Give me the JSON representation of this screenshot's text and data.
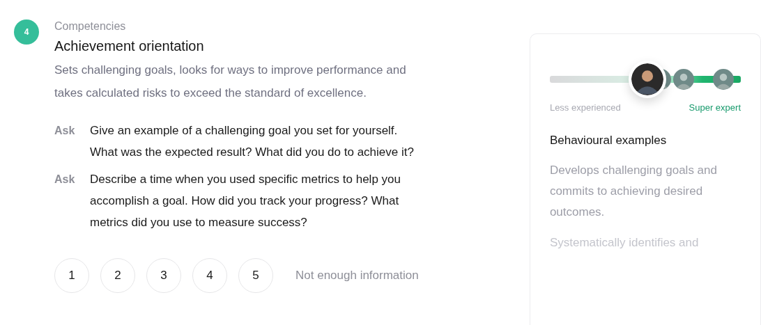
{
  "competency": {
    "number": "4",
    "category": "Competencies",
    "title": "Achievement orientation",
    "description": "Sets challenging goals, looks for ways to improve performance and takes calculated risks to exceed the standard of excellence."
  },
  "questions": [
    {
      "label": "Ask",
      "text": "Give an example of a challenging goal you set for yourself. What was the expected result? What did you do to achieve it?"
    },
    {
      "label": "Ask",
      "text": "Describe a time when you used specific metrics to help you accomplish a goal. How did you track your progress? What metrics did you use to measure success?"
    }
  ],
  "rating": {
    "options": [
      {
        "label": "1",
        "selected": false
      },
      {
        "label": "2",
        "selected": false
      },
      {
        "label": "3",
        "selected": false
      },
      {
        "label": "4",
        "selected": false
      },
      {
        "label": "5",
        "selected": false
      }
    ],
    "skip_label": "Not enough information"
  },
  "experience": {
    "min_label": "Less experienced",
    "max_label": "Super expert"
  },
  "examples": {
    "title": "Behavioural examples",
    "items": [
      "Develops challenging goals and commits to achieving desired outcomes.",
      "Systematically identifies and"
    ]
  }
}
